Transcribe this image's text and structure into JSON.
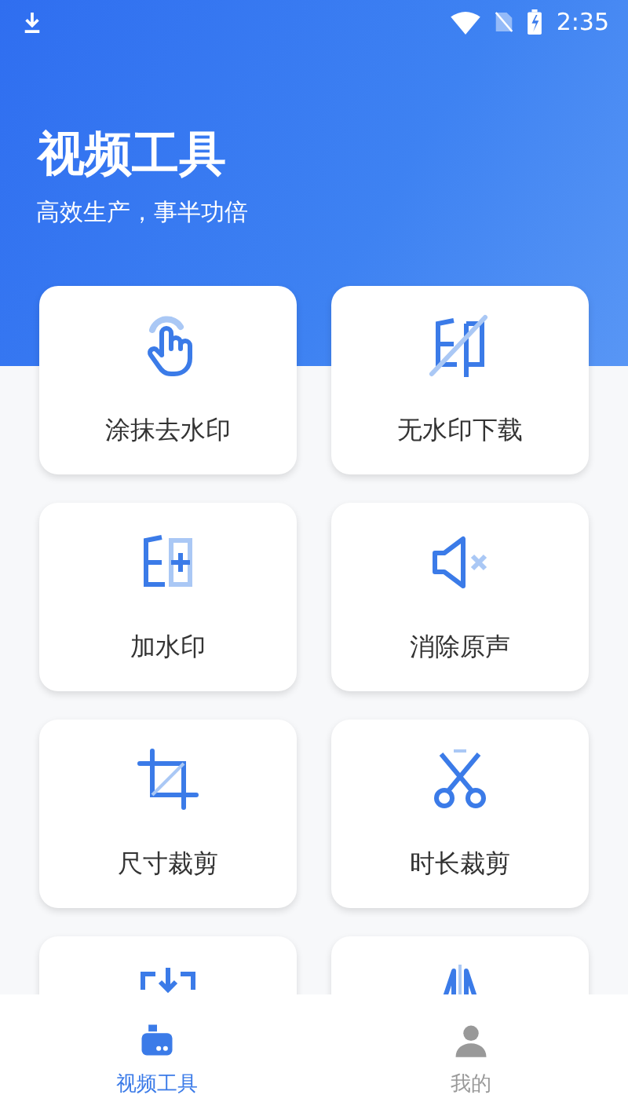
{
  "status_bar": {
    "time": "2:35"
  },
  "header": {
    "title": "视频工具",
    "subtitle": "高效生产，事半功倍"
  },
  "tools": [
    {
      "kind": "smear",
      "label": "涂抹去水印"
    },
    {
      "kind": "no-watermark",
      "label": "无水印下载"
    },
    {
      "kind": "add-watermark",
      "label": "加水印"
    },
    {
      "kind": "mute",
      "label": "消除原声"
    },
    {
      "kind": "crop",
      "label": "尺寸裁剪"
    },
    {
      "kind": "trim",
      "label": "时长裁剪"
    },
    {
      "kind": "import"
    },
    {
      "kind": "flip"
    }
  ],
  "bottom_nav": [
    {
      "kind": "camera",
      "label": "视频工具",
      "selected": true
    },
    {
      "kind": "person",
      "label": "我的",
      "selected": false
    }
  ]
}
